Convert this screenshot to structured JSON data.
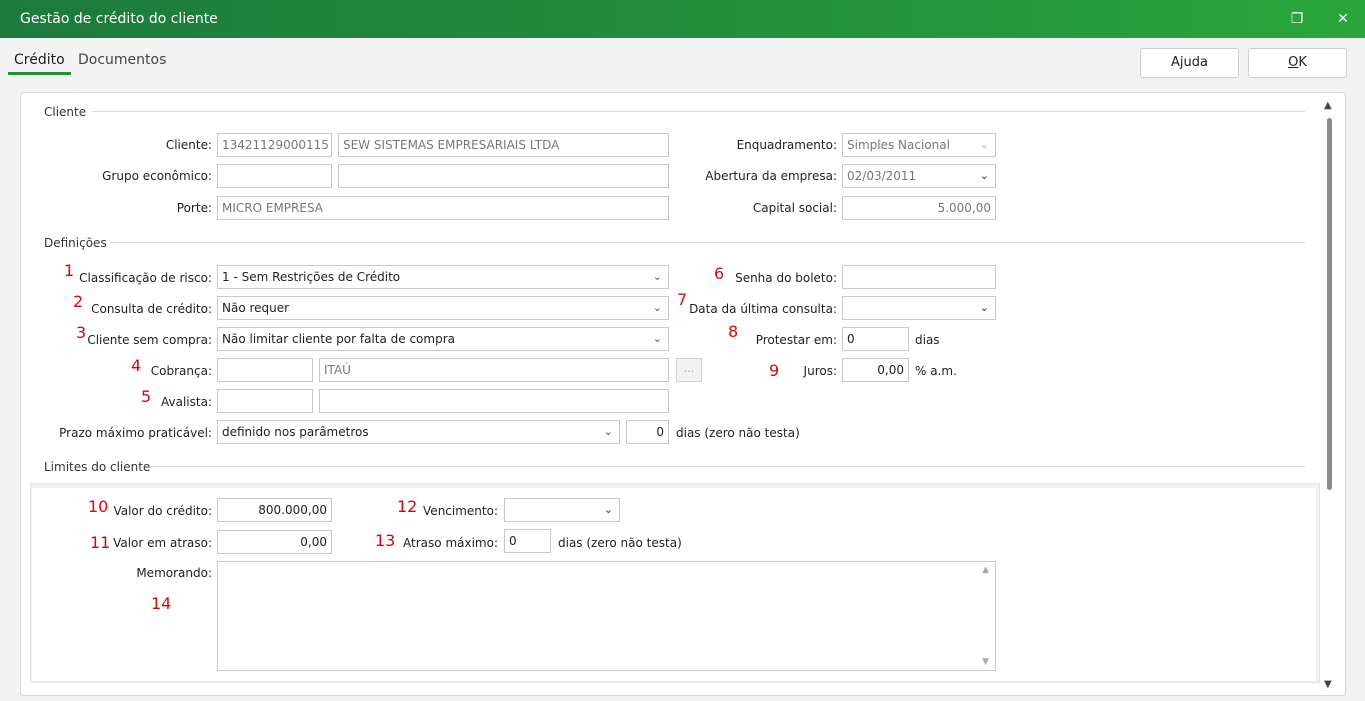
{
  "window": {
    "title": "Gestão de crédito do cliente",
    "restore_glyph": "❐",
    "close_glyph": "✕"
  },
  "tabs": [
    {
      "label": "Crédito"
    },
    {
      "label": "Documentos"
    }
  ],
  "buttons": {
    "help": "Ajuda",
    "ok_prefix": "",
    "ok_underlined": "O",
    "ok_rest": "K"
  },
  "sections": {
    "cliente": "Cliente",
    "definicoes": "Definições",
    "limites": "Limites do cliente"
  },
  "cliente": {
    "cliente_label": "Cliente:",
    "cliente_code": "13421129000115",
    "cliente_name": "SEW SISTEMAS EMPRESARIAIS LTDA",
    "grupo_label": "Grupo econômico:",
    "grupo_code": "",
    "grupo_name": "",
    "porte_label": "Porte:",
    "porte_value": "MICRO EMPRESA",
    "enquadramento_label": "Enquadramento:",
    "enquadramento_value": "Simples Nacional",
    "abertura_label": "Abertura da empresa:",
    "abertura_value": "02/03/2011",
    "capital_label": "Capital social:",
    "capital_value": "5.000,00"
  },
  "definicoes": {
    "risco_label": "Classificação de risco:",
    "risco_value": "1 - Sem Restrições de Crédito",
    "consulta_label": "Consulta de crédito:",
    "consulta_value": "Não requer",
    "sem_compra_label": "Cliente sem compra:",
    "sem_compra_value": "Não limitar cliente por falta de compra",
    "cobranca_label": "Cobrança:",
    "cobranca_code": "",
    "cobranca_name": "ITAÚ",
    "cobranca_btn": "...",
    "avalista_label": "Avalista:",
    "avalista_code": "",
    "avalista_name": "",
    "prazo_label": "Prazo máximo praticável:",
    "prazo_value": "definido nos parâmetros",
    "prazo_days": "0",
    "prazo_suffix": "dias (zero não testa)",
    "senha_label": "Senha do boleto:",
    "senha_value": "",
    "ultima_consulta_label": "Data da última consulta:",
    "ultima_consulta_value": "",
    "protestar_label": "Protestar em:",
    "protestar_value": "0",
    "protestar_suffix": "dias",
    "juros_label": "Juros:",
    "juros_value": "0,00",
    "juros_suffix": "% a.m."
  },
  "limites": {
    "valor_credito_label": "Valor do crédito:",
    "valor_credito_value": "800.000,00",
    "valor_atraso_label": "Valor em atraso:",
    "valor_atraso_value": "0,00",
    "vencimento_label": "Vencimento:",
    "vencimento_value": "",
    "atraso_max_label": "Atraso máximo:",
    "atraso_max_value": "0",
    "atraso_max_suffix": "dias (zero não testa)",
    "memorando_label": "Memorando:",
    "memorando_value": ""
  },
  "annotations": [
    "1",
    "2",
    "3",
    "4",
    "5",
    "6",
    "7",
    "8",
    "9",
    "10",
    "11",
    "12",
    "13",
    "14"
  ],
  "icons": {
    "combo_arrow": "⌄",
    "scroll_up": "▲",
    "scroll_down": "▼"
  },
  "colors": {
    "titlebar": "#23913c",
    "annotation": "#d10a0a",
    "tab_underline": "#23913c"
  }
}
